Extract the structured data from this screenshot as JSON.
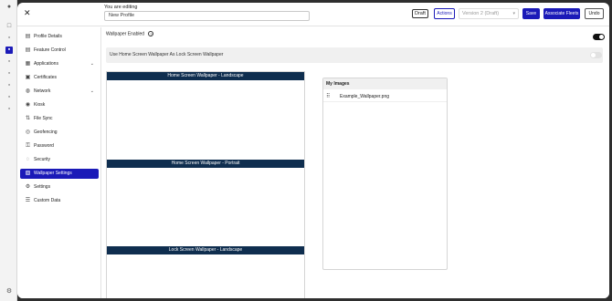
{
  "header": {
    "editing_label": "You are editing",
    "profile_name": "New Profile",
    "draft_badge": "Draft",
    "actions_label": "Actions",
    "version_label": "Version 2 (Draft)",
    "save_label": "Save",
    "associate_label": "Associate Fleets",
    "undo_label": "Undo"
  },
  "sidebar": {
    "items": [
      {
        "label": "Profile Details",
        "icon": "document-icon"
      },
      {
        "label": "Feature Control",
        "icon": "document-icon"
      },
      {
        "label": "Applications",
        "icon": "grid-icon"
      },
      {
        "label": "Certificates",
        "icon": "certificate-icon"
      },
      {
        "label": "Network",
        "icon": "globe-icon"
      },
      {
        "label": "Kiosk",
        "icon": "pin-icon"
      },
      {
        "label": "File Sync",
        "icon": "sync-icon"
      },
      {
        "label": "Geofencing",
        "icon": "geofence-icon"
      },
      {
        "label": "Password",
        "icon": "key-icon"
      },
      {
        "label": "Security",
        "icon": "shield-icon"
      },
      {
        "label": "Wallpaper Settings",
        "icon": "image-icon"
      },
      {
        "label": "Settings",
        "icon": "gear-icon"
      },
      {
        "label": "Custom Data",
        "icon": "list-icon"
      }
    ],
    "active": "Wallpaper Settings"
  },
  "content": {
    "wallpaper_enabled_label": "Wallpaper Enabled",
    "wallpaper_enabled": true,
    "use_home_as_lock_label": "Use Home Screen Wallpaper As Lock Screen Wallpaper",
    "use_home_as_lock": false,
    "sections": [
      "Home Screen Wallpaper - Landscape",
      "Home Screen Wallpaper - Portrait",
      "Lock Screen Wallpaper - Landscape"
    ],
    "images_title": "My Images",
    "images": [
      "Example_Wallpaper.png"
    ]
  },
  "colors": {
    "accent": "#1b1ab8",
    "section_bar": "#0f2e4f"
  }
}
